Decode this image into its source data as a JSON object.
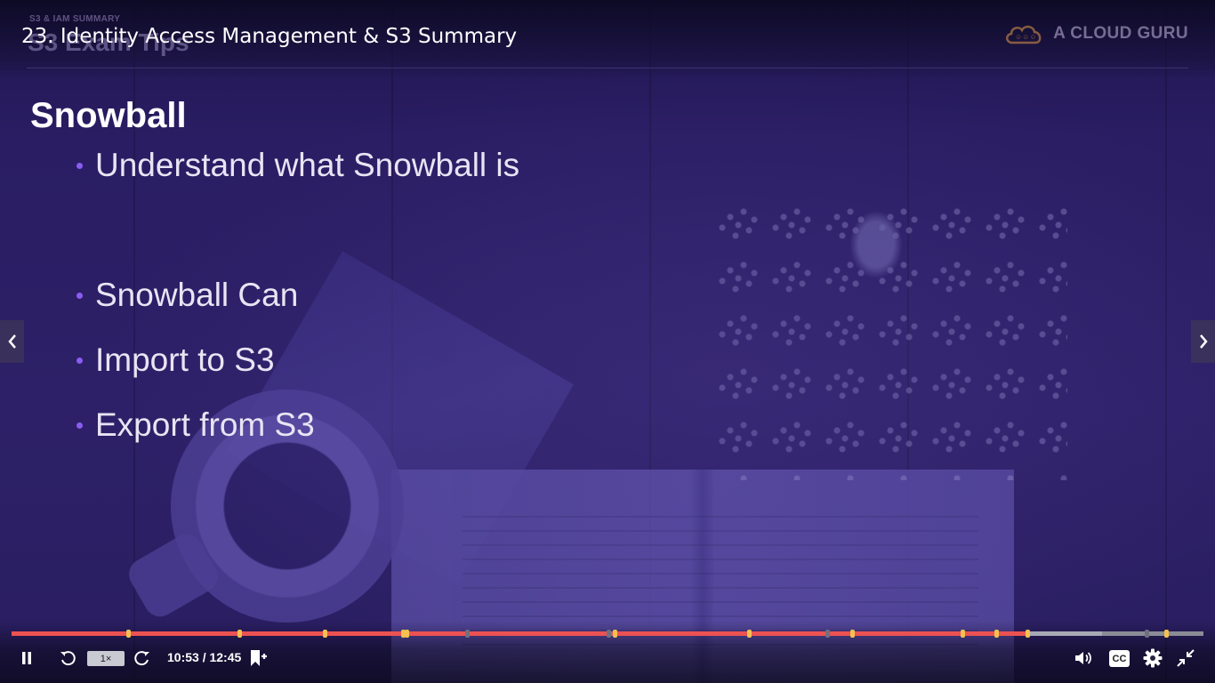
{
  "video": {
    "title": "23. Identity Access Management & S3 Summary"
  },
  "slide": {
    "kicker": "S3 & IAM SUMMARY",
    "heading": "S3 Exam Tips",
    "brand": "A CLOUD GURU",
    "title": "Snowball",
    "bullets": [
      "Understand what Snowball is",
      "Snowball Can",
      "Import to S3",
      "Export from S3"
    ]
  },
  "player": {
    "speed": "1×",
    "current_time": "10:53",
    "separator": " / ",
    "duration": "12:45",
    "progress_fraction": 0.8536,
    "buffered_fraction": 0.915,
    "cc_label": "CC",
    "colors": {
      "progress": "#ec5252",
      "buffer": "#a7a9b4",
      "track": "#8b8c96",
      "marker": "#f4c150",
      "marker_viewed": "#6f7180",
      "bullet_dot": "#8a5cf0"
    }
  },
  "markers": [
    {
      "fraction": 0.098,
      "viewed": false
    },
    {
      "fraction": 0.191,
      "viewed": false
    },
    {
      "fraction": 0.263,
      "viewed": false
    },
    {
      "fraction": 0.328,
      "viewed": false
    },
    {
      "fraction": 0.331,
      "viewed": false
    },
    {
      "fraction": 0.382,
      "viewed": true
    },
    {
      "fraction": 0.501,
      "viewed": true
    },
    {
      "fraction": 0.506,
      "viewed": false
    },
    {
      "fraction": 0.619,
      "viewed": false
    },
    {
      "fraction": 0.684,
      "viewed": true
    },
    {
      "fraction": 0.705,
      "viewed": false
    },
    {
      "fraction": 0.798,
      "viewed": false
    },
    {
      "fraction": 0.826,
      "viewed": false
    },
    {
      "fraction": 0.852,
      "viewed": false
    },
    {
      "fraction": 0.952,
      "viewed": true
    },
    {
      "fraction": 0.969,
      "viewed": false
    }
  ],
  "icons": {
    "pause": "pause-icon",
    "rewind": "rewind-icon",
    "forward": "forward-icon",
    "bookmark": "add-bookmark-icon",
    "volume": "volume-icon",
    "settings": "gear-icon",
    "fullscreen": "exit-fullscreen-icon",
    "prev": "chevron-left-icon",
    "next": "chevron-right-icon",
    "brand": "cloud-logo-icon"
  }
}
